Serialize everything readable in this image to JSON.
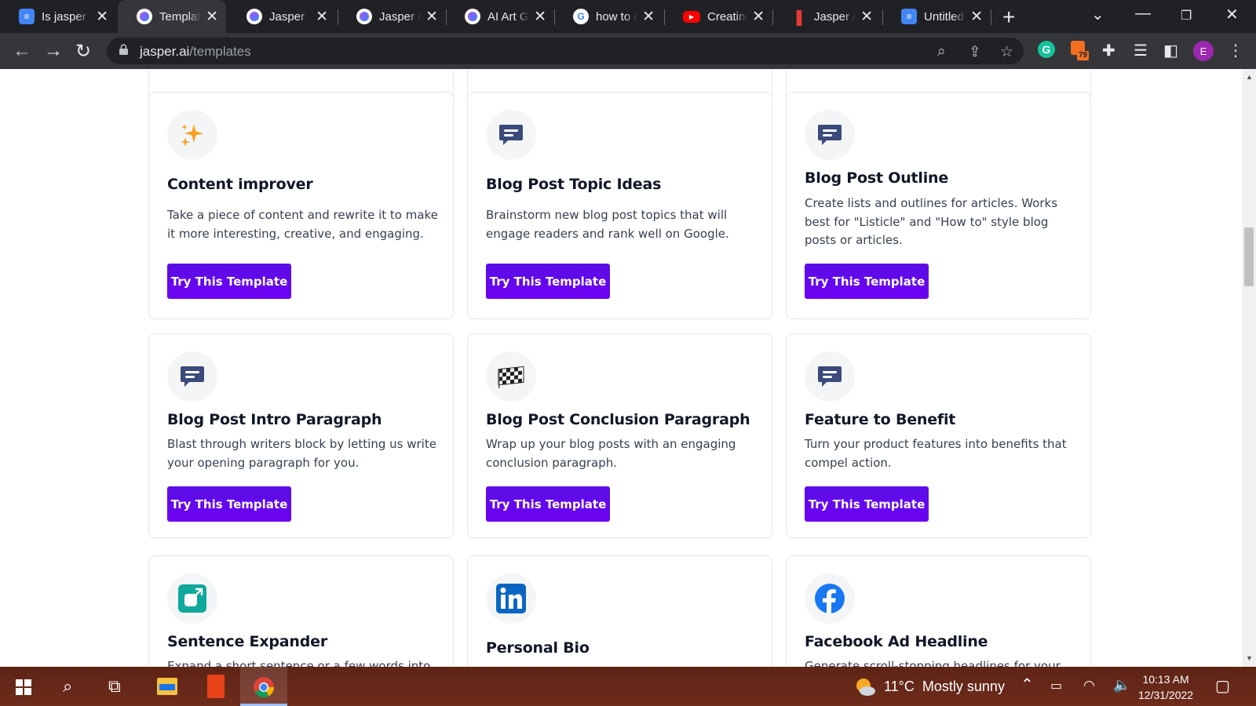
{
  "browser": {
    "tabs": [
      {
        "title": "Is jasper",
        "favicon": "docs-icon",
        "color": "#4285f4"
      },
      {
        "title": "Templates",
        "favicon": "jasper-icon",
        "color": "#ffffff",
        "active": true
      },
      {
        "title": "Jasper - A",
        "favicon": "jasper-icon",
        "color": "#ffffff"
      },
      {
        "title": "Jasper Co",
        "favicon": "jasper-icon",
        "color": "#ffffff"
      },
      {
        "title": "AI Art Ge",
        "favicon": "jasper-icon",
        "color": "#ffffff"
      },
      {
        "title": "how to c",
        "favicon": "google-icon",
        "color": "#ffffff"
      },
      {
        "title": "Creating",
        "favicon": "youtube-icon",
        "color": "#ff0000"
      },
      {
        "title": "Jasper AI",
        "favicon": "bookmark-icon",
        "color": "#e53935"
      },
      {
        "title": "Untitled",
        "favicon": "docs-icon",
        "color": "#4285f4"
      }
    ],
    "url_domain": "jasper.ai",
    "url_path": "/templates",
    "extension_badge": "79",
    "profile_initial": "E"
  },
  "templates": [
    {
      "title": "Content improver",
      "description": "Take a piece of content and rewrite it to make it more interesting, creative, and engaging.",
      "icon": "sparkle-icon",
      "button": "Try This Template"
    },
    {
      "title": "Blog Post Topic Ideas",
      "description": "Brainstorm new blog post topics that will engage readers and rank well on Google.",
      "icon": "chat-bubble-icon",
      "button": "Try This Template"
    },
    {
      "title": "Blog Post Outline",
      "description": "Create lists and outlines for articles. Works best for \"Listicle\" and \"How to\" style blog posts or articles.",
      "icon": "chat-bubble-icon",
      "button": "Try This Template"
    },
    {
      "title": "Blog Post Intro Paragraph",
      "description": "Blast through writers block by letting us write your opening paragraph for you.",
      "icon": "chat-bubble-icon",
      "button": "Try This Template"
    },
    {
      "title": "Blog Post Conclusion Paragraph",
      "description": "Wrap up your blog posts with an engaging conclusion paragraph.",
      "icon": "checkered-flag-icon",
      "button": "Try This Template"
    },
    {
      "title": "Feature to Benefit",
      "description": "Turn your product features into benefits that compel action.",
      "icon": "chat-bubble-icon",
      "button": "Try This Template"
    },
    {
      "title": "Sentence Expander",
      "description": "Expand a short sentence or a few words into a",
      "icon": "expand-icon"
    },
    {
      "title": "Personal Bio",
      "description": "",
      "icon": "linkedin-icon"
    },
    {
      "title": "Facebook Ad Headline",
      "description": "Generate scroll-stopping headlines for your",
      "icon": "facebook-icon"
    }
  ],
  "taskbar": {
    "temperature": "11°C",
    "weather": "Mostly sunny",
    "time": "10:13 AM",
    "date": "12/31/2022"
  },
  "colors": {
    "button": "#6b00ff",
    "chat_icon": "#3b4a7a",
    "sparkle": "#f7a21b"
  }
}
